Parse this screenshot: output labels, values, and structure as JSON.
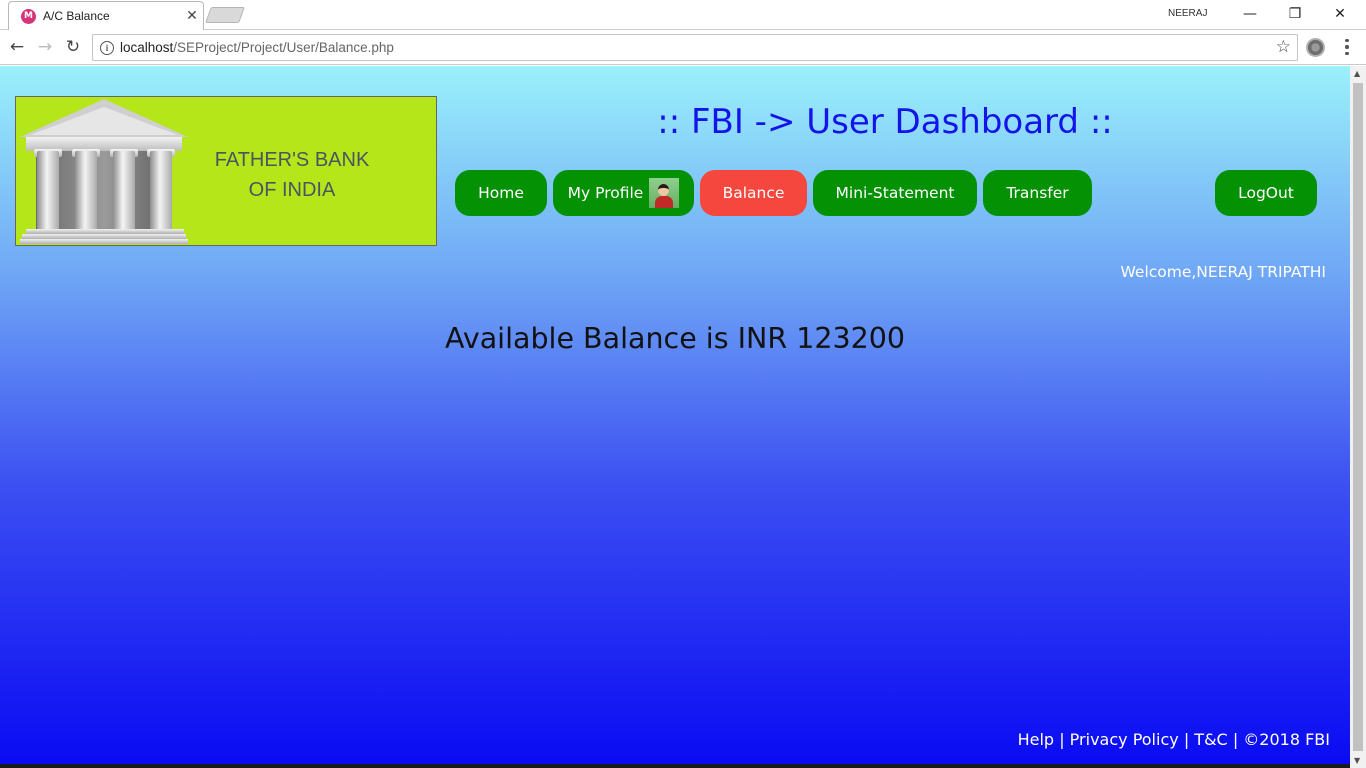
{
  "browser": {
    "tab_title": "A/C Balance",
    "favicon_icon": "app-favicon-icon",
    "profile_name": "NEERAJ",
    "url_host": "localhost",
    "url_path": "/SEProject/Project/User/Balance.php",
    "window_controls": {
      "minimize": "—",
      "restore": "❐",
      "close": "✕"
    },
    "nav": {
      "back": "←",
      "forward": "→",
      "reload": "↻",
      "star": "☆",
      "tab_close": "✕"
    }
  },
  "page": {
    "logo": {
      "line1": "FATHER'S BANK",
      "line2": "OF INDIA",
      "icon": "bank-building-icon"
    },
    "title": ":: FBI -> User Dashboard ::",
    "nav": [
      {
        "label": "Home",
        "active": false
      },
      {
        "label": "My Profile",
        "active": false
      },
      {
        "label": "Balance",
        "active": true
      },
      {
        "label": "Mini-Statement",
        "active": false
      },
      {
        "label": "Transfer",
        "active": false
      },
      {
        "label": "LogOut",
        "active": false
      }
    ],
    "welcome": "Welcome,NEERAJ TRIPATHI",
    "balance_text": "Available Balance is INR 123200",
    "footer": {
      "help": "Help",
      "sep1": "|",
      "privacy": "Privacy Policy",
      "sep2": "|",
      "terms": "T&C",
      "sep3": "|",
      "copyright": "©2018 FBI"
    }
  },
  "colors": {
    "nav_button": "#049104",
    "nav_active": "#f5473d",
    "title": "#1414ea",
    "logo_bg": "#b4e61a",
    "bg_top": "#9af1fb",
    "bg_bottom": "#0a0bf3"
  }
}
